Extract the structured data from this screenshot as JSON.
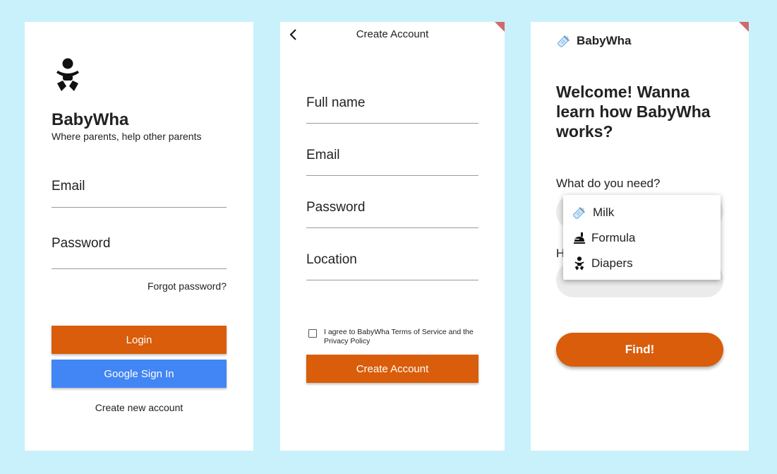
{
  "login": {
    "logo_icon": "baby-icon",
    "app_name": "BabyWha",
    "tagline": "Where parents, help other parents",
    "email_label": "Email",
    "password_label": "Password",
    "forgot_password": "Forgot password?",
    "login_button": "Login",
    "google_button": "Google Sign In",
    "create_account_link": "Create new account"
  },
  "signup": {
    "back_icon": "chevron-left-icon",
    "title": "Create Account",
    "fields": {
      "full_name": "Full name",
      "email": "Email",
      "password": "Password",
      "location": "Location"
    },
    "agree_text": "I agree to BabyWha Terms of Service and the Privacy Policy",
    "submit_button": "Create Account"
  },
  "home": {
    "brand_icon": "baby-bottle-icon",
    "brand_name": "BabyWha",
    "welcome": "Welcome! Wanna learn how BabyWha works?",
    "need_label": "What do you need?",
    "how_label_fragment": "H",
    "find_button": "Find!",
    "menu_options": [
      {
        "label": "Milk",
        "icon": "baby-bottle-icon"
      },
      {
        "label": "Formula",
        "icon": "formula-icon"
      },
      {
        "label": "Diapers",
        "icon": "baby-icon"
      }
    ]
  },
  "colors": {
    "background": "#c9f1fb",
    "accent_orange": "#d95d0a",
    "google_blue": "#4285f4"
  }
}
